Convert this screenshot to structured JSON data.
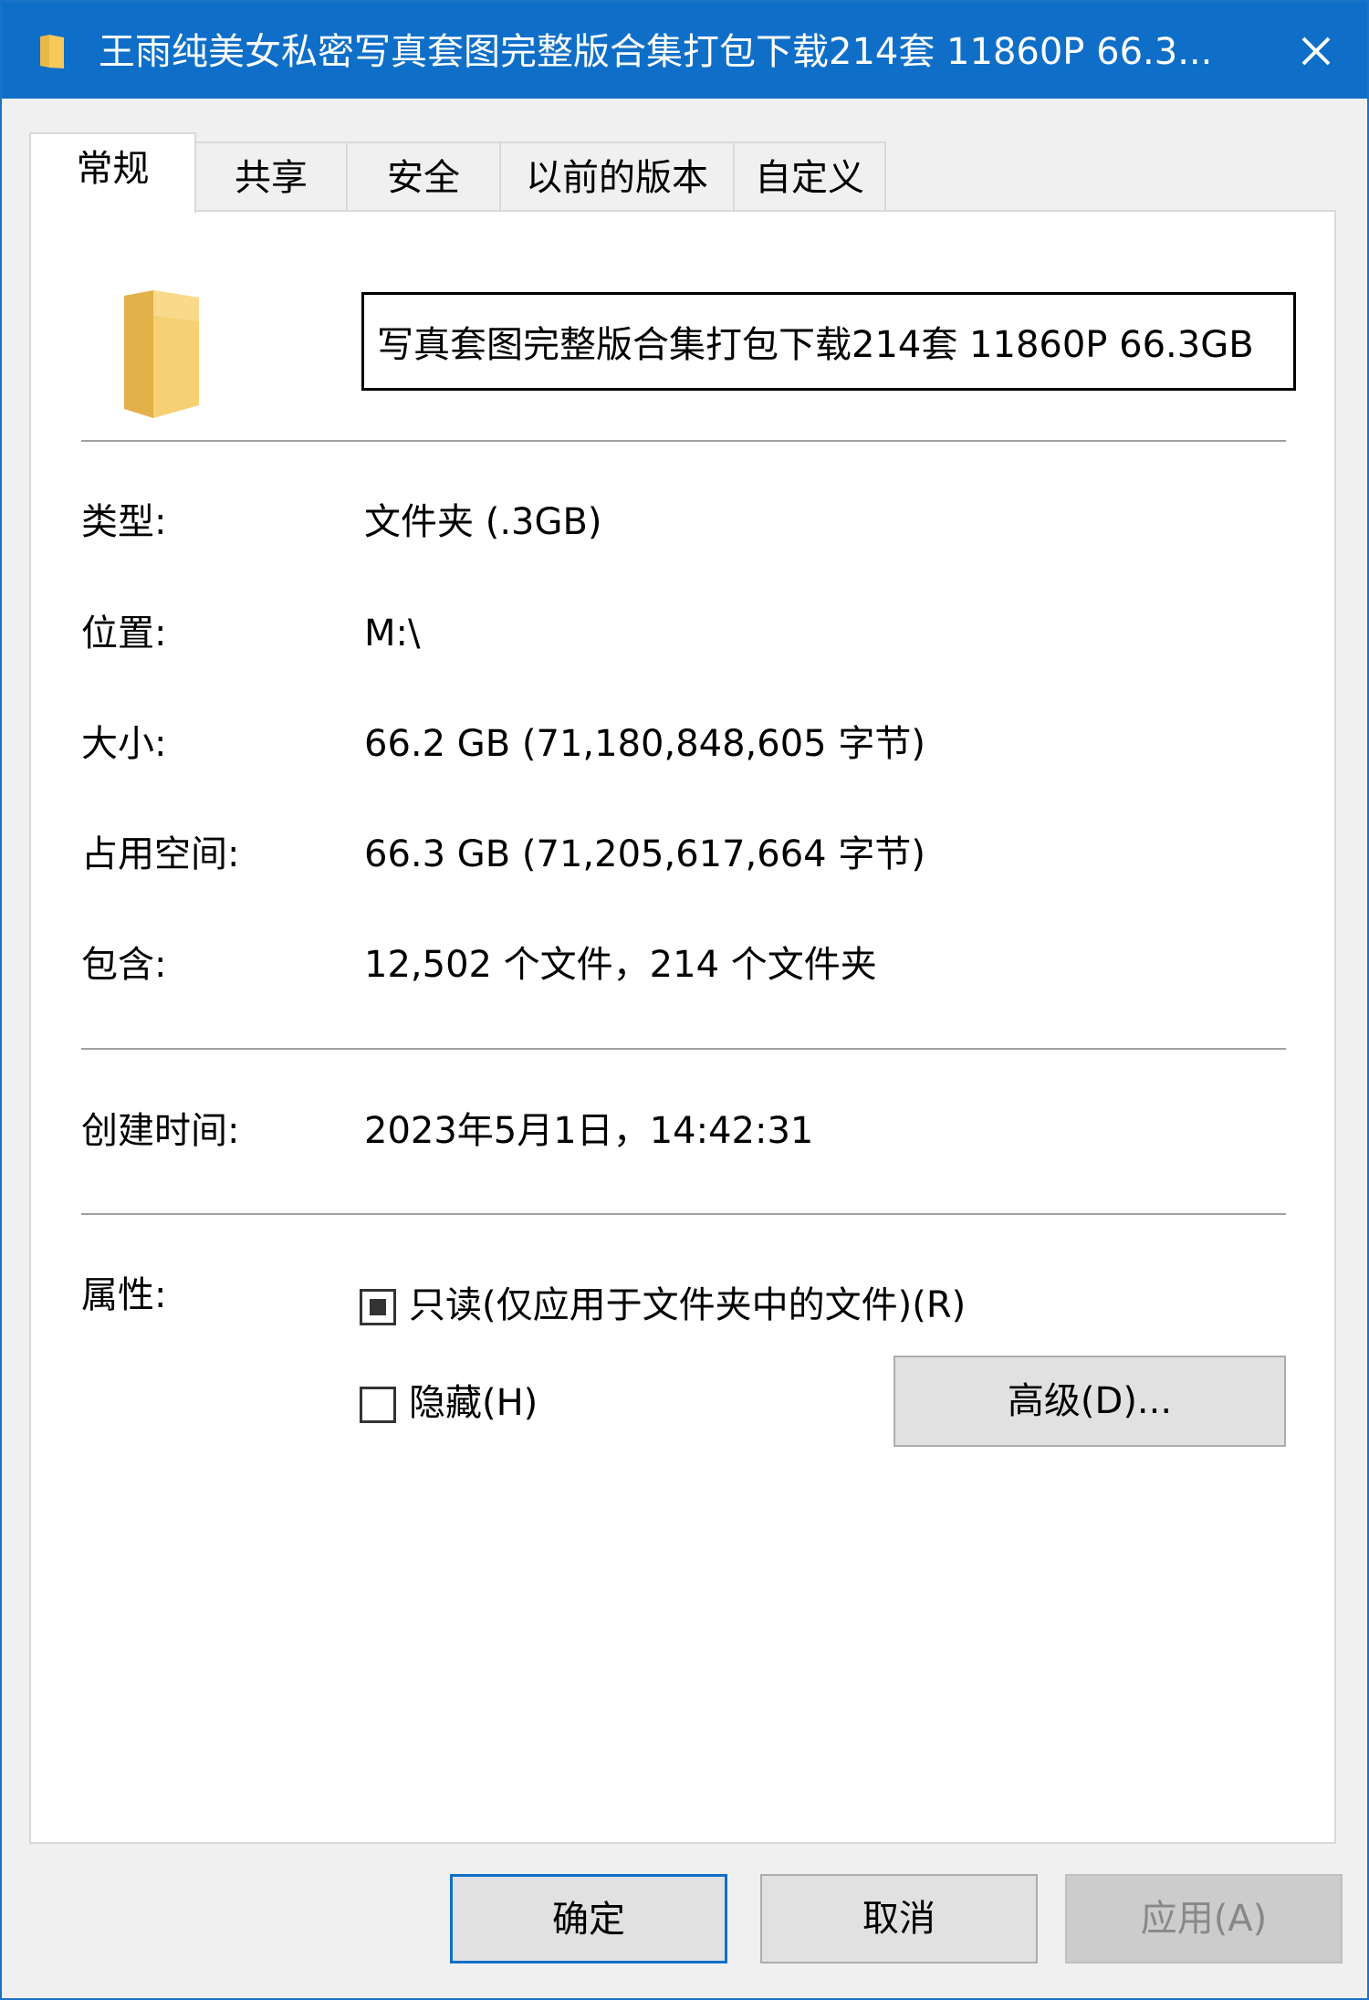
{
  "window": {
    "title": "王雨纯美女私密写真套图完整版合集打包下载214套 11860P 66.3...",
    "close_glyph": "✕"
  },
  "tabs": [
    {
      "label": "常规",
      "active": true
    },
    {
      "label": "共享",
      "active": false
    },
    {
      "label": "安全",
      "active": false
    },
    {
      "label": "以前的版本",
      "active": false
    },
    {
      "label": "自定义",
      "active": false
    }
  ],
  "general": {
    "folder_name_value": "写真套图完整版合集打包下载214套 11860P 66.3GB",
    "rows": {
      "type": {
        "label": "类型:",
        "value": "文件夹 (.3GB)"
      },
      "location": {
        "label": "位置:",
        "value": "M:\\"
      },
      "size": {
        "label": "大小:",
        "value": "66.2 GB (71,180,848,605 字节)"
      },
      "size_on_disk": {
        "label": "占用空间:",
        "value": "66.3 GB (71,205,617,664 字节)"
      },
      "contains": {
        "label": "包含:",
        "value": "12,502 个文件，214 个文件夹"
      },
      "created": {
        "label": "创建时间:",
        "value": "2023年5月1日，14:42:31"
      }
    },
    "attributes": {
      "label": "属性:",
      "readonly": {
        "label": "只读(仅应用于文件夹中的文件)(R)",
        "state": "indeterminate"
      },
      "hidden": {
        "label": "隐藏(H)",
        "state": "unchecked"
      },
      "advanced_label": "高级(D)..."
    }
  },
  "buttons": {
    "ok": "确定",
    "cancel": "取消",
    "apply": "应用(A)"
  },
  "colors": {
    "titlebar": "#0f6fc8",
    "folder": "#f5c95c",
    "default_button_border": "#0f6fc8"
  }
}
